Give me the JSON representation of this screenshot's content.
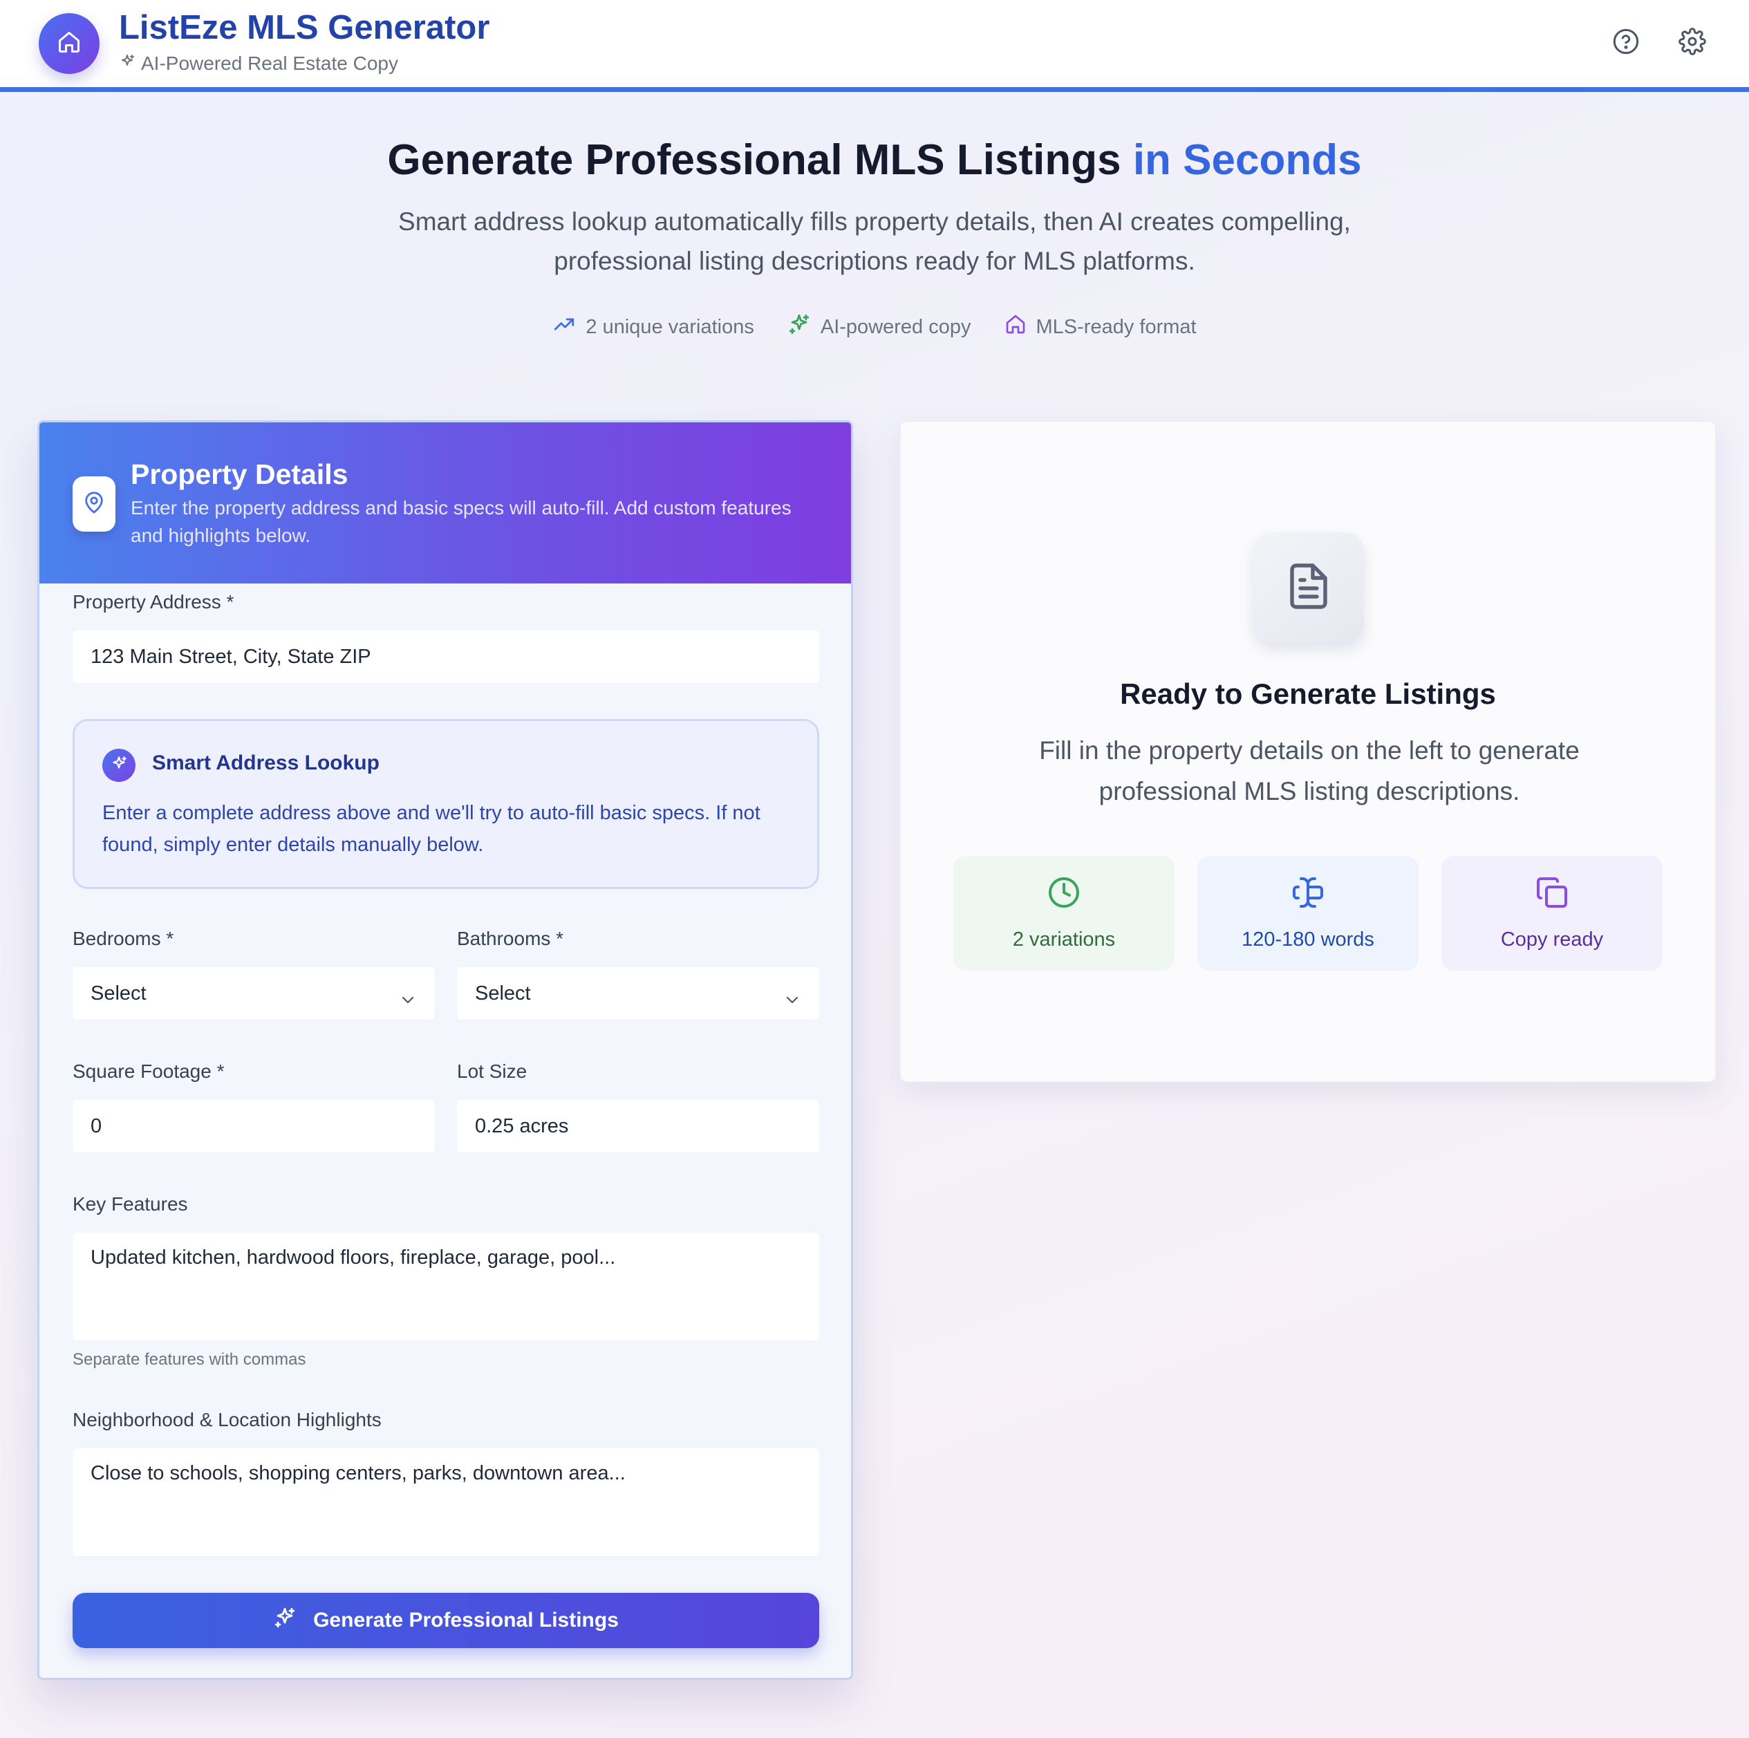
{
  "app": {
    "title": "ListEze MLS Generator",
    "subtitle": "AI-Powered Real Estate Copy",
    "logo_icon": "home-icon",
    "help_icon": "help-circle-icon",
    "settings_icon": "gear-icon"
  },
  "hero": {
    "title_main": "Generate Professional MLS Listings",
    "title_accent": "in Seconds",
    "description": "Smart address lookup automatically fills property details, then AI creates compelling, professional listing descriptions ready for MLS platforms.",
    "tags": [
      {
        "label": "2 unique variations",
        "icon": "trending-up-icon",
        "color": "#3f6fe0"
      },
      {
        "label": "AI-powered copy",
        "icon": "sparkles-icon",
        "color": "#3aa45a"
      },
      {
        "label": "MLS-ready format",
        "icon": "home-icon",
        "color": "#8a4de0"
      }
    ]
  },
  "form": {
    "title": "Property Details",
    "description": "Enter the property address and basic specs will auto-fill. Add custom features and highlights below.",
    "address": {
      "label": "Property Address *",
      "placeholder": "123 Main Street, City, State ZIP"
    },
    "lookup": {
      "title": "Smart Address Lookup",
      "description": "Enter a complete address above and we'll try to auto-fill basic specs. If not found, simply enter details manually below."
    },
    "bedrooms": {
      "label": "Bedrooms *",
      "value": "Select"
    },
    "bathrooms": {
      "label": "Bathrooms *",
      "value": "Select"
    },
    "sqft": {
      "label": "Square Footage *",
      "placeholder": "0"
    },
    "lot": {
      "label": "Lot Size",
      "placeholder": "0.25 acres"
    },
    "features": {
      "label": "Key Features",
      "placeholder": "Updated kitchen, hardwood floors, fireplace, garage, pool...",
      "hint": "Separate features with commas"
    },
    "neighborhood": {
      "label": "Neighborhood & Location Highlights",
      "placeholder": "Close to schools, shopping centers, parks, downtown area..."
    },
    "submit_label": "Generate Professional Listings"
  },
  "output": {
    "title": "Ready to Generate Listings",
    "description": "Fill in the property details on the left to generate professional MLS listing descriptions.",
    "stats": [
      {
        "label": "2 variations",
        "icon": "clock-icon"
      },
      {
        "label": "120-180 words",
        "icon": "text-cursor-icon"
      },
      {
        "label": "Copy ready",
        "icon": "copy-icon"
      }
    ]
  },
  "colors": {
    "brand": "#2343a8",
    "accent": "#3566e0",
    "button": "#3a62e0",
    "header_border": "#3f6fe0"
  }
}
